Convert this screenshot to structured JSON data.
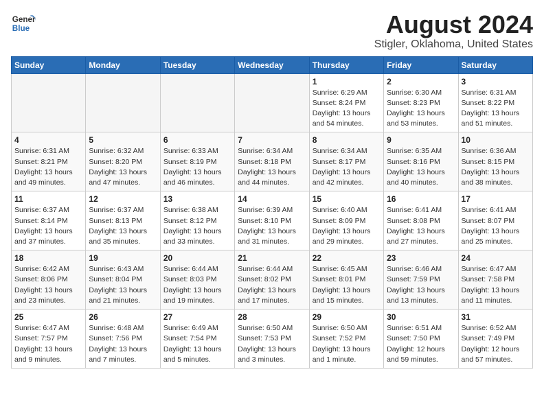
{
  "header": {
    "logo": {
      "line1": "General",
      "line2": "Blue"
    },
    "title": "August 2024",
    "subtitle": "Stigler, Oklahoma, United States"
  },
  "calendar": {
    "weekdays": [
      "Sunday",
      "Monday",
      "Tuesday",
      "Wednesday",
      "Thursday",
      "Friday",
      "Saturday"
    ],
    "weeks": [
      [
        {
          "day": "",
          "info": ""
        },
        {
          "day": "",
          "info": ""
        },
        {
          "day": "",
          "info": ""
        },
        {
          "day": "",
          "info": ""
        },
        {
          "day": "1",
          "info": "Sunrise: 6:29 AM\nSunset: 8:24 PM\nDaylight: 13 hours\nand 54 minutes."
        },
        {
          "day": "2",
          "info": "Sunrise: 6:30 AM\nSunset: 8:23 PM\nDaylight: 13 hours\nand 53 minutes."
        },
        {
          "day": "3",
          "info": "Sunrise: 6:31 AM\nSunset: 8:22 PM\nDaylight: 13 hours\nand 51 minutes."
        }
      ],
      [
        {
          "day": "4",
          "info": "Sunrise: 6:31 AM\nSunset: 8:21 PM\nDaylight: 13 hours\nand 49 minutes."
        },
        {
          "day": "5",
          "info": "Sunrise: 6:32 AM\nSunset: 8:20 PM\nDaylight: 13 hours\nand 47 minutes."
        },
        {
          "day": "6",
          "info": "Sunrise: 6:33 AM\nSunset: 8:19 PM\nDaylight: 13 hours\nand 46 minutes."
        },
        {
          "day": "7",
          "info": "Sunrise: 6:34 AM\nSunset: 8:18 PM\nDaylight: 13 hours\nand 44 minutes."
        },
        {
          "day": "8",
          "info": "Sunrise: 6:34 AM\nSunset: 8:17 PM\nDaylight: 13 hours\nand 42 minutes."
        },
        {
          "day": "9",
          "info": "Sunrise: 6:35 AM\nSunset: 8:16 PM\nDaylight: 13 hours\nand 40 minutes."
        },
        {
          "day": "10",
          "info": "Sunrise: 6:36 AM\nSunset: 8:15 PM\nDaylight: 13 hours\nand 38 minutes."
        }
      ],
      [
        {
          "day": "11",
          "info": "Sunrise: 6:37 AM\nSunset: 8:14 PM\nDaylight: 13 hours\nand 37 minutes."
        },
        {
          "day": "12",
          "info": "Sunrise: 6:37 AM\nSunset: 8:13 PM\nDaylight: 13 hours\nand 35 minutes."
        },
        {
          "day": "13",
          "info": "Sunrise: 6:38 AM\nSunset: 8:12 PM\nDaylight: 13 hours\nand 33 minutes."
        },
        {
          "day": "14",
          "info": "Sunrise: 6:39 AM\nSunset: 8:10 PM\nDaylight: 13 hours\nand 31 minutes."
        },
        {
          "day": "15",
          "info": "Sunrise: 6:40 AM\nSunset: 8:09 PM\nDaylight: 13 hours\nand 29 minutes."
        },
        {
          "day": "16",
          "info": "Sunrise: 6:41 AM\nSunset: 8:08 PM\nDaylight: 13 hours\nand 27 minutes."
        },
        {
          "day": "17",
          "info": "Sunrise: 6:41 AM\nSunset: 8:07 PM\nDaylight: 13 hours\nand 25 minutes."
        }
      ],
      [
        {
          "day": "18",
          "info": "Sunrise: 6:42 AM\nSunset: 8:06 PM\nDaylight: 13 hours\nand 23 minutes."
        },
        {
          "day": "19",
          "info": "Sunrise: 6:43 AM\nSunset: 8:04 PM\nDaylight: 13 hours\nand 21 minutes."
        },
        {
          "day": "20",
          "info": "Sunrise: 6:44 AM\nSunset: 8:03 PM\nDaylight: 13 hours\nand 19 minutes."
        },
        {
          "day": "21",
          "info": "Sunrise: 6:44 AM\nSunset: 8:02 PM\nDaylight: 13 hours\nand 17 minutes."
        },
        {
          "day": "22",
          "info": "Sunrise: 6:45 AM\nSunset: 8:01 PM\nDaylight: 13 hours\nand 15 minutes."
        },
        {
          "day": "23",
          "info": "Sunrise: 6:46 AM\nSunset: 7:59 PM\nDaylight: 13 hours\nand 13 minutes."
        },
        {
          "day": "24",
          "info": "Sunrise: 6:47 AM\nSunset: 7:58 PM\nDaylight: 13 hours\nand 11 minutes."
        }
      ],
      [
        {
          "day": "25",
          "info": "Sunrise: 6:47 AM\nSunset: 7:57 PM\nDaylight: 13 hours\nand 9 minutes."
        },
        {
          "day": "26",
          "info": "Sunrise: 6:48 AM\nSunset: 7:56 PM\nDaylight: 13 hours\nand 7 minutes."
        },
        {
          "day": "27",
          "info": "Sunrise: 6:49 AM\nSunset: 7:54 PM\nDaylight: 13 hours\nand 5 minutes."
        },
        {
          "day": "28",
          "info": "Sunrise: 6:50 AM\nSunset: 7:53 PM\nDaylight: 13 hours\nand 3 minutes."
        },
        {
          "day": "29",
          "info": "Sunrise: 6:50 AM\nSunset: 7:52 PM\nDaylight: 13 hours\nand 1 minute."
        },
        {
          "day": "30",
          "info": "Sunrise: 6:51 AM\nSunset: 7:50 PM\nDaylight: 12 hours\nand 59 minutes."
        },
        {
          "day": "31",
          "info": "Sunrise: 6:52 AM\nSunset: 7:49 PM\nDaylight: 12 hours\nand 57 minutes."
        }
      ]
    ]
  }
}
